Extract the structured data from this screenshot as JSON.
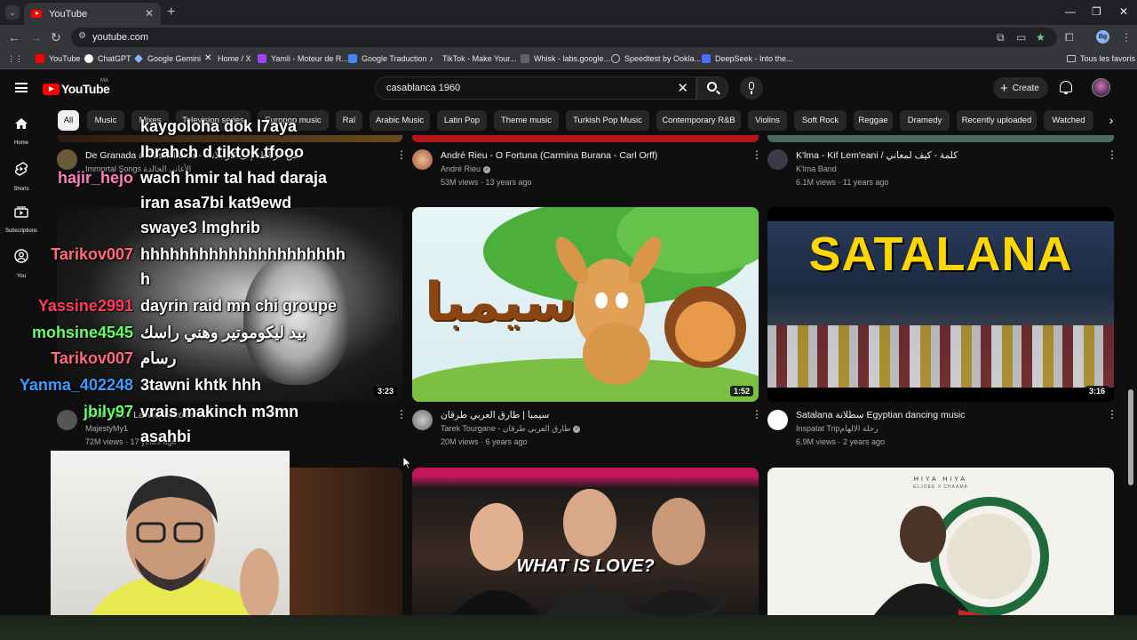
{
  "browser": {
    "tab_title": "YouTube",
    "url": "youtube.com",
    "profile_initials": "Bg",
    "bookmarks": [
      {
        "label": "YouTube",
        "color": "#ff0000"
      },
      {
        "label": "ChatGPT",
        "color": "#ffffff"
      },
      {
        "label": "Google Gemini",
        "color": "#8ab4f8"
      },
      {
        "label": "Home / X",
        "color": "#ffffff"
      },
      {
        "label": "Yamli - Moteur de R...",
        "color": "#a142f4"
      },
      {
        "label": "Google Traduction",
        "color": "#4285f4"
      },
      {
        "label": "TikTok - Make Your...",
        "color": "#ffffff"
      },
      {
        "label": "Whisk - labs.google...",
        "color": "#888888"
      },
      {
        "label": "Speedtest by Ookla...",
        "color": "#cccccc"
      },
      {
        "label": "DeepSeek - Into the...",
        "color": "#4d6bfe"
      }
    ],
    "all_bookmarks": "Tous les favoris"
  },
  "youtube": {
    "logo_text": "YouTube",
    "country_code": "MA",
    "search_query": "casablanca 1960",
    "create_label": "Create",
    "sidebar": [
      {
        "label": "Home",
        "icon": "home-icon"
      },
      {
        "label": "Shorts",
        "icon": "shorts-icon"
      },
      {
        "label": "Subscriptions",
        "icon": "subscriptions-icon"
      },
      {
        "label": "You",
        "icon": "you-icon"
      }
    ],
    "chips": [
      "All",
      "Music",
      "Mixes",
      "Television series",
      "Europop music",
      "Raï",
      "Arabic Music",
      "Latin Pop",
      "Theme music",
      "Turkish Pop Music",
      "Contemporary R&B",
      "Violins",
      "Soft Rock",
      "Reggae",
      "Dramedy",
      "Recently uploaded",
      "Watched"
    ]
  },
  "videos_row1": [
    {
      "title": "De Granada a Casablanca - من غرناطة إلى كازابلانكا",
      "channel": "Immortal Songs الأغاني الخالدة",
      "meta": ""
    },
    {
      "title": "André Rieu - O Fortuna (Carmina Burana - Carl Orff)",
      "channel": "André Rieu",
      "meta": "53M views · 13 years ago",
      "verified": true
    },
    {
      "title": "K'lma - Kif Lem'eani / كلمة - كيف لمعاني",
      "channel": "K'lma Band",
      "meta": "6.1M views · 11 years ago"
    }
  ],
  "videos_row2": [
    {
      "title": "Edith Piaf - La Vie en rose",
      "channel": "MajestyMy1",
      "meta": "72M views · 17 years ago",
      "duration": "3:23"
    },
    {
      "title": "سيمبا | طارق العربي طرقان",
      "channel": "Tarek Tourgane - طارق العربي طرقان",
      "meta": "20M views · 6 years ago",
      "duration": "1:52",
      "verified": true,
      "thumb_text": "سيمبا"
    },
    {
      "title": "Satalana سطلانة Egyptian dancing music",
      "channel": "Inspatat Tripرحلة الالهام",
      "meta": "6.9M views · 2 years ago",
      "duration": "3:16",
      "thumb_text": "SATALANA"
    }
  ],
  "videos_row3": [
    {
      "thumb_text": ""
    },
    {
      "thumb_text": "WHAT IS LOVE?"
    },
    {
      "thumb_text": "HIYA HIYA",
      "thumb_sub": "ELJOEE X CHAAMA"
    }
  ],
  "chat_overlay": [
    {
      "user": "",
      "user_color": "#ffffff",
      "message": "kaygoloha dok l7aya"
    },
    {
      "user": "",
      "user_color": "#ffffff",
      "message": "lbrahch d tiktok tfooo"
    },
    {
      "user": "hajir_hejo",
      "user_color": "#ff7fbf",
      "message": "wach hmir tal had daraja"
    },
    {
      "user": "",
      "user_color": "#ffffff",
      "message": "iran asa7bi kat9ewd"
    },
    {
      "user": "",
      "user_color": "#ffffff",
      "message": "swaye3 lmghrib"
    },
    {
      "user": "Tarikov007",
      "user_color": "#ff6b7a",
      "message": "hhhhhhhhhhhhhhhhhhhhh"
    },
    {
      "user": "",
      "user_color": "#ffffff",
      "message": "h"
    },
    {
      "user": "Yassine2991",
      "user_color": "#ff3b5a",
      "message": "dayrin raid mn chi groupe"
    },
    {
      "user": "mohsine4545",
      "user_color": "#66ff66",
      "message": "بيد ليكوموتير وهني راسك"
    },
    {
      "user": "Tarikov007",
      "user_color": "#ff6b7a",
      "message": "رسام"
    },
    {
      "user": "Yanma_402248",
      "user_color": "#3b9dff",
      "message": "3tawni khtk hhh"
    },
    {
      "user": "jbily97",
      "user_color": "#66ff66",
      "message": "vrais makinch m3mn"
    },
    {
      "user": "",
      "user_color": "#ffffff",
      "message": "asahbi"
    }
  ],
  "colors": {
    "background": "#0f0f0f",
    "accent_red": "#ff0000",
    "chip_bg": "#272727"
  }
}
